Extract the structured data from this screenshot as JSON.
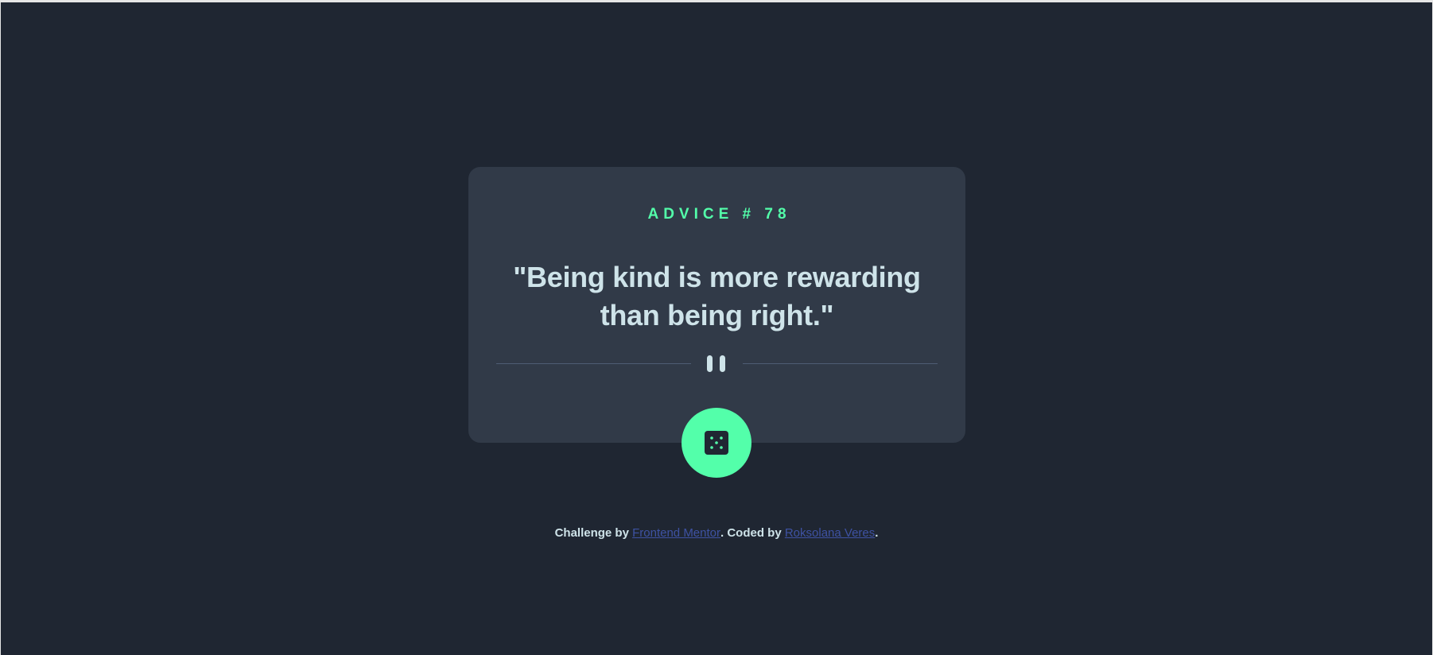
{
  "advice": {
    "number_label": "ADVICE # 78",
    "quote": "\"Being kind is more rewarding than being right.\""
  },
  "divider": {
    "icon": "pause-icon"
  },
  "dice_button": {
    "icon": "dice-icon"
  },
  "attribution": {
    "prefix": "Challenge by ",
    "link1": "Frontend Mentor",
    "middle": ". Coded by ",
    "link2": "Roksolana Veres",
    "suffix": "."
  },
  "colors": {
    "background": "#1f2632",
    "card": "#313a48",
    "accent": "#53ffaa",
    "text": "#cee3e9",
    "divider": "#4f5d74",
    "link": "#3e52a3"
  }
}
